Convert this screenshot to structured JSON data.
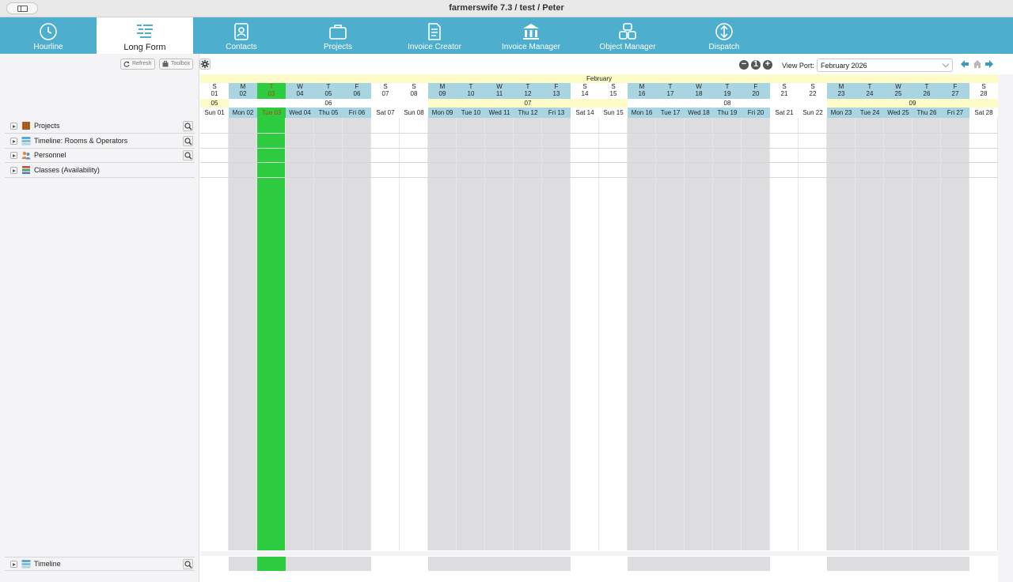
{
  "window": {
    "title": "farmerswife 7.3  / test / Peter"
  },
  "nav": {
    "tabs": [
      {
        "label": "Hourline",
        "icon": "clock-icon",
        "active": false
      },
      {
        "label": "Long Form",
        "icon": "long-form-icon",
        "active": true
      },
      {
        "label": "Contacts",
        "icon": "contacts-icon",
        "active": false
      },
      {
        "label": "Projects",
        "icon": "briefcase-icon",
        "active": false
      },
      {
        "label": "Invoice Creator",
        "icon": "document-icon",
        "active": false
      },
      {
        "label": "Invoice Manager",
        "icon": "bank-icon",
        "active": false
      },
      {
        "label": "Object Manager",
        "icon": "objects-icon",
        "active": false
      },
      {
        "label": "Dispatch",
        "icon": "dispatch-icon",
        "active": false
      }
    ]
  },
  "toolbar": {
    "refresh_label": "Refresh",
    "toolbox_label": "Toolbox"
  },
  "tree": {
    "rows": [
      {
        "label": "Projects",
        "icon": "projects-icon",
        "search": true
      },
      {
        "label": "Timeline: Rooms & Operators",
        "icon": "timeline-icon",
        "search": true
      },
      {
        "label": "Personnel",
        "icon": "personnel-icon",
        "search": true
      },
      {
        "label": "Classes (Availability)",
        "icon": "classes-icon",
        "search": false
      }
    ],
    "footer": {
      "label": "Timeline",
      "icon": "timeline-icon"
    }
  },
  "viewport": {
    "label": "View Port:",
    "value": "February 2026"
  },
  "zoom": {
    "minus": "−",
    "reset": "1",
    "plus": "+"
  },
  "calendar": {
    "month": "February",
    "weeks": [
      {
        "label": "05",
        "start": 0,
        "span": 1
      },
      {
        "label": "06",
        "start": 1,
        "span": 7
      },
      {
        "label": "07",
        "start": 8,
        "span": 7
      },
      {
        "label": "08",
        "start": 15,
        "span": 7
      },
      {
        "label": "09",
        "start": 22,
        "span": 6
      }
    ],
    "days": [
      {
        "letter": "S",
        "num": "01",
        "label": "Sun 01",
        "type": "we"
      },
      {
        "letter": "M",
        "num": "02",
        "label": "Mon 02",
        "type": "wk"
      },
      {
        "letter": "T",
        "num": "03",
        "label": "Tue 03",
        "type": "today"
      },
      {
        "letter": "W",
        "num": "04",
        "label": "Wed 04",
        "type": "wk"
      },
      {
        "letter": "T",
        "num": "05",
        "label": "Thu 05",
        "type": "wk"
      },
      {
        "letter": "F",
        "num": "06",
        "label": "Fri 06",
        "type": "wk"
      },
      {
        "letter": "S",
        "num": "07",
        "label": "Sat 07",
        "type": "we"
      },
      {
        "letter": "S",
        "num": "08",
        "label": "Sun 08",
        "type": "we"
      },
      {
        "letter": "M",
        "num": "09",
        "label": "Mon 09",
        "type": "wk"
      },
      {
        "letter": "T",
        "num": "10",
        "label": "Tue 10",
        "type": "wk"
      },
      {
        "letter": "W",
        "num": "11",
        "label": "Wed 11",
        "type": "wk"
      },
      {
        "letter": "T",
        "num": "12",
        "label": "Thu 12",
        "type": "wk"
      },
      {
        "letter": "F",
        "num": "13",
        "label": "Fri 13",
        "type": "wk"
      },
      {
        "letter": "S",
        "num": "14",
        "label": "Sat 14",
        "type": "we"
      },
      {
        "letter": "S",
        "num": "15",
        "label": "Sun 15",
        "type": "we"
      },
      {
        "letter": "M",
        "num": "16",
        "label": "Mon 16",
        "type": "wk"
      },
      {
        "letter": "T",
        "num": "17",
        "label": "Tue 17",
        "type": "wk"
      },
      {
        "letter": "W",
        "num": "18",
        "label": "Wed 18",
        "type": "wk"
      },
      {
        "letter": "T",
        "num": "19",
        "label": "Thu 19",
        "type": "wk"
      },
      {
        "letter": "F",
        "num": "20",
        "label": "Fri 20",
        "type": "wk"
      },
      {
        "letter": "S",
        "num": "21",
        "label": "Sat 21",
        "type": "we"
      },
      {
        "letter": "S",
        "num": "22",
        "label": "Sun 22",
        "type": "we"
      },
      {
        "letter": "M",
        "num": "23",
        "label": "Mon 23",
        "type": "wk"
      },
      {
        "letter": "T",
        "num": "24",
        "label": "Tue 24",
        "type": "wk"
      },
      {
        "letter": "W",
        "num": "25",
        "label": "Wed 25",
        "type": "wk"
      },
      {
        "letter": "T",
        "num": "26",
        "label": "Thu 26",
        "type": "wk"
      },
      {
        "letter": "F",
        "num": "27",
        "label": "Fri 27",
        "type": "wk"
      },
      {
        "letter": "S",
        "num": "28",
        "label": "Sat 28",
        "type": "we"
      }
    ]
  },
  "colors": {
    "accent": "#4eaecd",
    "today": "#2ecc40",
    "weekday": "#a9d5e3",
    "highlight": "#fdfcc8"
  }
}
